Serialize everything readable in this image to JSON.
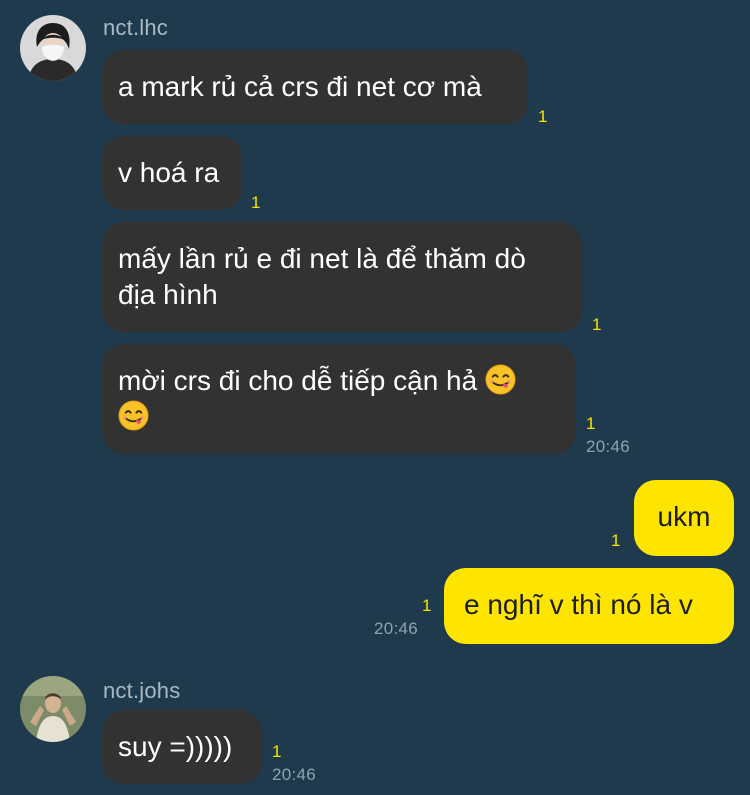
{
  "conversation": {
    "accent_color": "#fde500",
    "background_color": "#1f3a4d",
    "incoming_bubble_color": "#323232",
    "groups": [
      {
        "sender": "nct.lhc",
        "avatar_icon": "profile-photo-masked-person",
        "messages": [
          {
            "text": "a mark rủ cả crs đi net cơ mà",
            "unread": "1"
          },
          {
            "text": "v hoá ra",
            "unread": "1"
          },
          {
            "text": "mấy lần rủ e đi net là để thăm dò địa hình",
            "unread": "1"
          },
          {
            "text": "mời crs đi cho dễ tiếp cận hả",
            "emoji": "smiling-face-savoring-food",
            "unread": "1",
            "time": "20:46"
          }
        ]
      },
      {
        "sender": "me",
        "messages": [
          {
            "text": "ukm",
            "unread": "1"
          },
          {
            "text": "e nghĩ v thì nó là v",
            "unread": "1",
            "time": "20:46"
          }
        ]
      },
      {
        "sender": "nct.johs",
        "avatar_icon": "profile-photo-person-on-green",
        "messages": [
          {
            "text": "suy =)))))",
            "unread": "1",
            "time": "20:46"
          }
        ]
      }
    ]
  }
}
